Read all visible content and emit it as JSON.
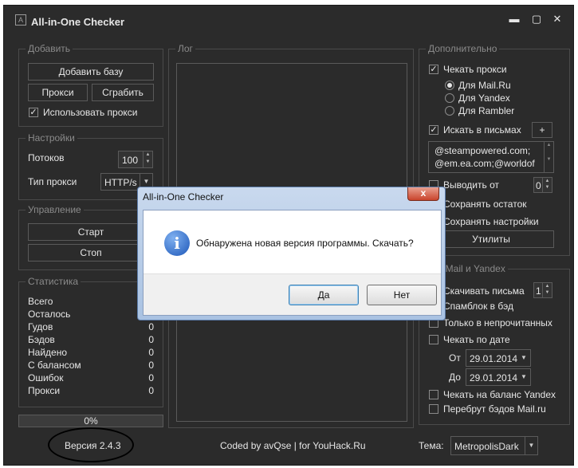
{
  "window": {
    "title": "All-in-One Checker",
    "icon": "app-icon",
    "controls": [
      "minimize-icon",
      "maximize-icon",
      "close-icon"
    ],
    "min_glyph": "▬",
    "max_glyph": "▢",
    "close_glyph": "✕"
  },
  "add_group": {
    "title": "Добавить",
    "add_base_label": "Добавить базу",
    "proxy_label": "Прокси",
    "grab_label": "Сграбить",
    "use_proxy_label": "Использовать прокси",
    "use_proxy_checked": true
  },
  "settings_group": {
    "title": "Настройки",
    "threads_label": "Потоков",
    "threads_value": "100",
    "proxy_type_label": "Тип прокси",
    "proxy_type_value": "HTTP/s"
  },
  "control_group": {
    "title": "Управление",
    "start_label": "Старт",
    "stop_label": "Стоп"
  },
  "stats_group": {
    "title": "Статистика",
    "rows": [
      {
        "label": "Всего",
        "value": ""
      },
      {
        "label": "Осталось",
        "value": ""
      },
      {
        "label": "Гудов",
        "value": "0"
      },
      {
        "label": "Бэдов",
        "value": "0"
      },
      {
        "label": "Найдено",
        "value": "0"
      },
      {
        "label": "С балансом",
        "value": "0"
      },
      {
        "label": "Ошибок",
        "value": "0"
      },
      {
        "label": "Прокси",
        "value": "0"
      }
    ]
  },
  "progress": {
    "value": 0,
    "label": "0%"
  },
  "log_group": {
    "title": "Лог"
  },
  "extra_group": {
    "title": "Дополнительно",
    "check_proxy_label": "Чекать прокси",
    "check_proxy_checked": true,
    "radios": [
      {
        "label": "Для Mail.Ru",
        "selected": true
      },
      {
        "label": "Для Yandex",
        "selected": false
      },
      {
        "label": "Для Rambler",
        "selected": false
      }
    ],
    "search_in_mail_label": "Искать в письмах",
    "search_in_mail_checked": true,
    "add_button_label": "+",
    "search_text_line1": "@steampowered.com;",
    "search_text_line2": "@em.ea.com;@worldof",
    "output_from_label": "Выводить от",
    "output_from_value": "0",
    "save_rest_label": "Сохранять остаток",
    "save_settings_label": "Сохранять настройки",
    "utilities_label": "Утилиты"
  },
  "mail_group": {
    "title": "ько Mail и Yandex",
    "download_label": "Скачивать письма",
    "download_value": "1",
    "spamblock_label": "Спамблок в бэд",
    "unread_label": "Только в непрочитанных",
    "check_by_date_label": "Чекать по дате",
    "from_label": "От",
    "from_value": "29.01.2014",
    "to_label": "До",
    "to_value": "29.01.2014",
    "yandex_balance_label": "Чекать на баланс Yandex",
    "bruteforce_label": "Перебрут бэдов Mail.ru"
  },
  "footer": {
    "version": "Версия 2.4.3",
    "credits": "Coded by avQse | for YouHack.Ru",
    "theme_label": "Тема:",
    "theme_value": "MetropolisDark"
  },
  "dialog": {
    "title": "All-in-One Checker",
    "message": "Обнаружена новая версия программы. Скачать?",
    "yes_label": "Да",
    "no_label": "Нет",
    "icon": "info-icon",
    "close_glyph": "x"
  },
  "colors": {
    "window_bg": "#2b2b2b",
    "border": "#4a4a4a",
    "text": "#e6e6e6",
    "muted_text": "#8a8a8a",
    "dialog_frame": "#a9c2e2"
  }
}
